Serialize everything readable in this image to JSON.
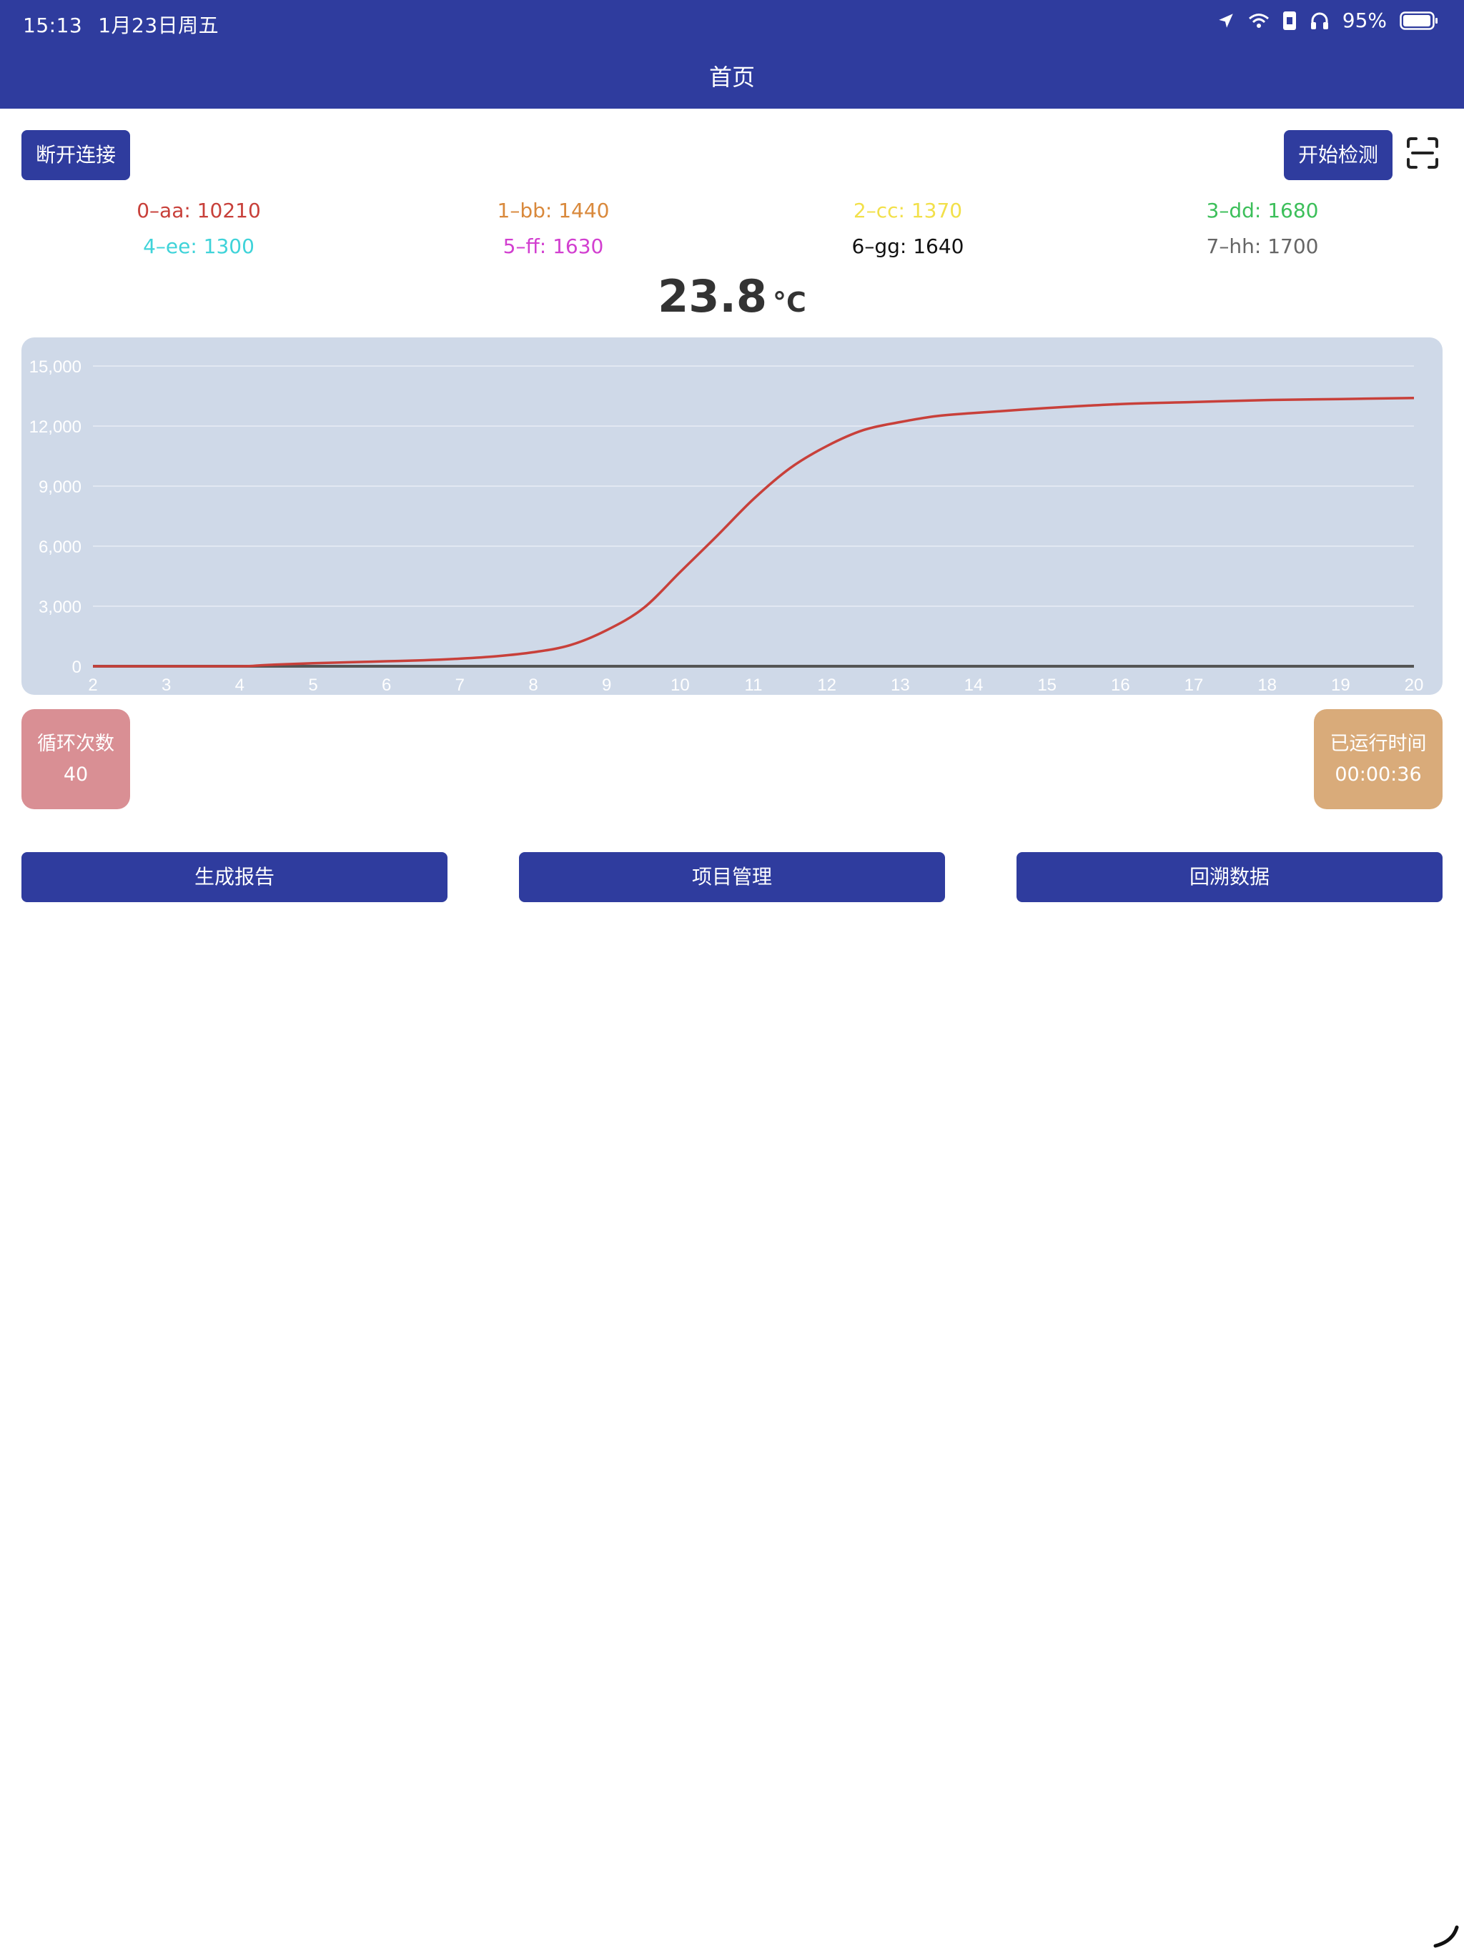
{
  "status_bar": {
    "time": "15:13",
    "date": "1月23日周五",
    "battery_percent": "95%",
    "icons": [
      "location-icon",
      "wifi-icon",
      "sim-icon",
      "headphones-icon",
      "battery-icon"
    ]
  },
  "nav": {
    "title": "首页"
  },
  "toolbar": {
    "disconnect_label": "断开连接",
    "start_label": "开始检测",
    "scan_icon": "scan-icon"
  },
  "channels": [
    {
      "label": "0–aa: 10210",
      "color": "#c8403a"
    },
    {
      "label": "1–bb: 1440",
      "color": "#d9893c"
    },
    {
      "label": "2–cc: 1370",
      "color": "#f2e04a"
    },
    {
      "label": "3–dd: 1680",
      "color": "#3cbf5a"
    },
    {
      "label": "4–ee: 1300",
      "color": "#3fd3d9"
    },
    {
      "label": "5–ff: 1630",
      "color": "#d23fd0"
    },
    {
      "label": "6–gg: 1640",
      "color": "#111111"
    },
    {
      "label": "7–hh: 1700",
      "color": "#666666"
    }
  ],
  "temperature": {
    "value": "23.8",
    "unit": "°C"
  },
  "chart_data": {
    "type": "line",
    "x_ticks": [
      "2",
      "3",
      "4",
      "5",
      "6",
      "7",
      "8",
      "9",
      "10",
      "11",
      "12",
      "13",
      "14",
      "15",
      "16",
      "17",
      "18",
      "19",
      "20"
    ],
    "y_ticks": [
      "0",
      "3,000",
      "6,000",
      "9,000",
      "12,000",
      "15,000"
    ],
    "xlim": [
      2,
      20
    ],
    "ylim": [
      0,
      15000
    ],
    "grid": true,
    "series": [
      {
        "color": "#c8403a",
        "x": [
          2,
          3,
          4,
          4.3,
          4.6,
          5,
          5.5,
          6,
          6.5,
          7,
          7.5,
          8,
          8.5,
          9,
          9.5,
          10,
          10.5,
          11,
          11.5,
          12,
          12.5,
          13,
          13.5,
          14,
          15,
          16,
          17,
          18,
          19,
          20
        ],
        "y": [
          0,
          0,
          0,
          50,
          100,
          150,
          200,
          250,
          300,
          380,
          500,
          700,
          1050,
          1800,
          2900,
          4700,
          6500,
          8350,
          9900,
          11000,
          11800,
          12200,
          12500,
          12650,
          12900,
          13100,
          13200,
          13300,
          13350,
          13400
        ]
      },
      {
        "color": "#555555",
        "x": [
          2,
          20
        ],
        "y": [
          0,
          0
        ]
      }
    ]
  },
  "cycles_card": {
    "title": "循环次数",
    "value": "40",
    "color": "#d98f94"
  },
  "runtime_card": {
    "title": "已运行时间",
    "value": "00:00:36",
    "color": "#d9ab7a"
  },
  "actions": {
    "report_label": "生成报告",
    "project_label": "项目管理",
    "history_label": "回溯数据"
  }
}
